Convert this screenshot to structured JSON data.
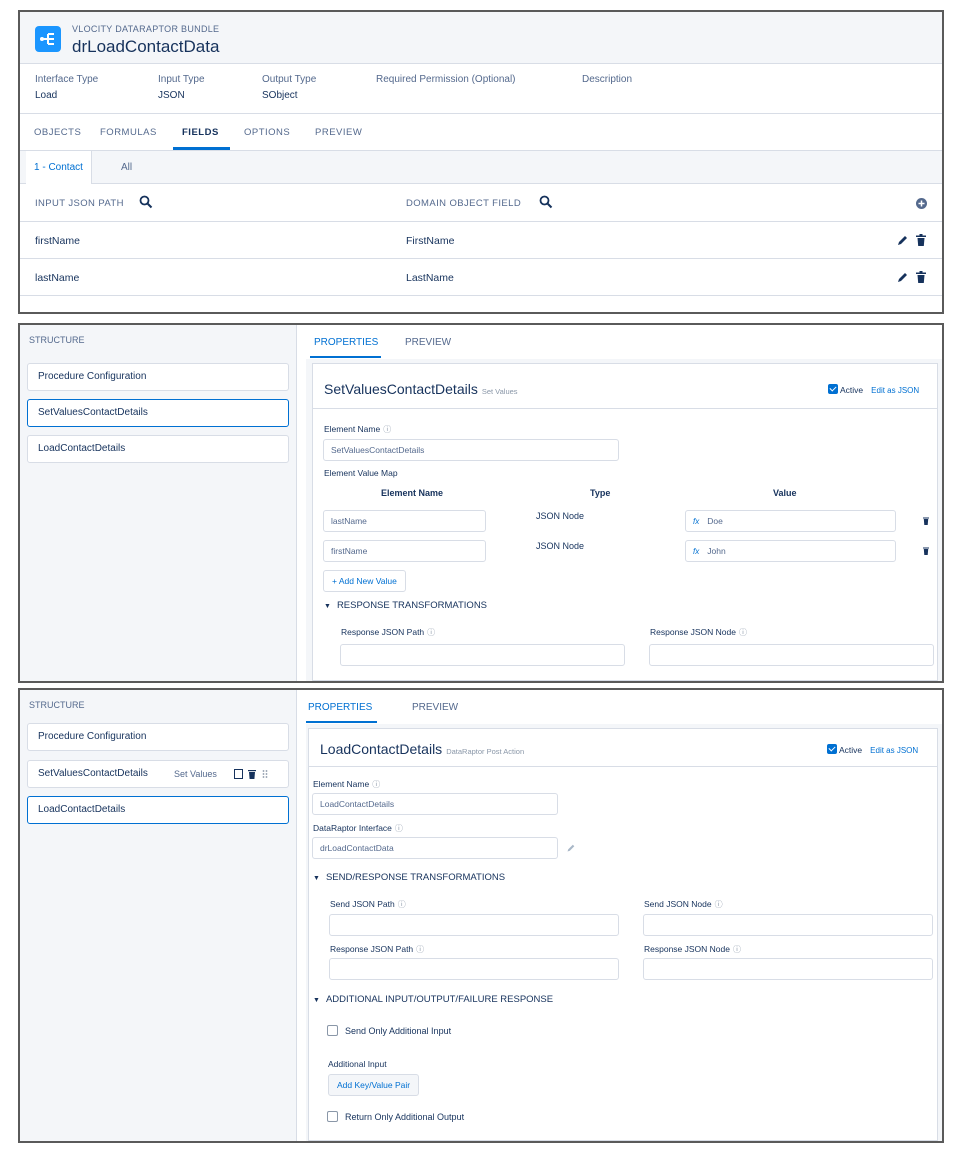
{
  "bundle": {
    "subtitle": "VLOCITY DATARAPTOR BUNDLE",
    "title": "drLoadContactData",
    "meta": [
      {
        "label": "Interface Type",
        "value": "Load"
      },
      {
        "label": "Input Type",
        "value": "JSON"
      },
      {
        "label": "Output Type",
        "value": "SObject"
      },
      {
        "label": "Required Permission (Optional)",
        "value": ""
      },
      {
        "label": "Description",
        "value": ""
      }
    ],
    "tabs": [
      "OBJECTS",
      "FORMULAS",
      "FIELDS",
      "OPTIONS",
      "PREVIEW"
    ],
    "active_tab": "FIELDS",
    "subtabs": [
      "1 - Contact",
      "All"
    ],
    "columns": {
      "input": "INPUT JSON PATH",
      "domain": "DOMAIN OBJECT FIELD"
    },
    "rows": [
      {
        "input": "firstName",
        "domain": "FirstName"
      },
      {
        "input": "lastName",
        "domain": "LastName"
      }
    ]
  },
  "setvalues": {
    "structure_label": "STRUCTURE",
    "structure_items": [
      "Procedure Configuration",
      "SetValuesContactDetails",
      "LoadContactDetails"
    ],
    "tab_properties": "PROPERTIES",
    "tab_preview": "PREVIEW",
    "title": "SetValuesContactDetails",
    "title_type": "Set Values",
    "active_label": "Active",
    "edit_json": "Edit as JSON",
    "element_name_label": "Element Name",
    "element_name_value": "SetValuesContactDetails",
    "value_map_label": "Element Value Map",
    "map_headers": {
      "name": "Element Name",
      "type": "Type",
      "value": "Value"
    },
    "map_rows": [
      {
        "name": "lastName",
        "type": "JSON Node",
        "value": "Doe"
      },
      {
        "name": "firstName",
        "type": "JSON Node",
        "value": "John"
      }
    ],
    "fx": "fx",
    "add_value": "+ Add New Value",
    "response_section": "RESPONSE TRANSFORMATIONS",
    "resp_path_label": "Response JSON Path",
    "resp_node_label": "Response JSON Node"
  },
  "loadcontact": {
    "structure_label": "STRUCTURE",
    "structure_items": [
      "Procedure Configuration",
      "SetValuesContactDetails",
      "LoadContactDetails"
    ],
    "set_values_tag": "Set Values",
    "tab_properties": "PROPERTIES",
    "tab_preview": "PREVIEW",
    "title": "LoadContactDetails",
    "title_type": "DataRaptor Post Action",
    "active_label": "Active",
    "edit_json": "Edit as JSON",
    "element_name_label": "Element Name",
    "element_name_value": "LoadContactDetails",
    "interface_label": "DataRaptor Interface",
    "interface_value": "drLoadContactData",
    "send_section": "SEND/RESPONSE TRANSFORMATIONS",
    "send_path_label": "Send JSON Path",
    "send_node_label": "Send JSON Node",
    "resp_path_label": "Response JSON Path",
    "resp_node_label": "Response JSON Node",
    "additional_section": "ADDITIONAL INPUT/OUTPUT/FAILURE RESPONSE",
    "send_only_label": "Send Only Additional Input",
    "additional_input_label": "Additional Input",
    "add_pair": "Add Key/Value Pair",
    "return_only_label": "Return Only Additional Output"
  },
  "colors": {
    "accent": "#0070d2",
    "panel_bg": "#f4f6f9",
    "border": "#d8dde6"
  }
}
